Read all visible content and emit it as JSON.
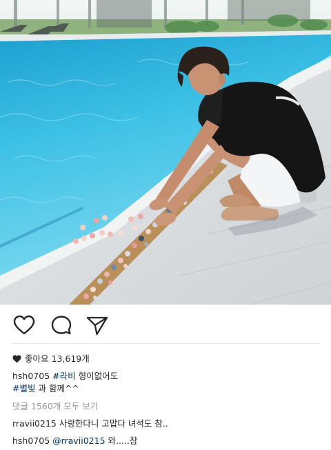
{
  "post": {
    "likes_label": "좋아요",
    "likes_count": "13,619개",
    "caption": {
      "username": "hsh0705",
      "hashtag1": "#라비",
      "text1": "형이없어도",
      "hashtag2": "#별빛",
      "text2": "과 함께^^"
    },
    "view_comments": "댓글 1560개 모두 보기",
    "comments": [
      {
        "username": "rravii0215",
        "text": "사랑한다니 고맙다 녀석도 참.."
      },
      {
        "username": "hsh0705",
        "mention": "@rravii0215",
        "text": "와.....참"
      }
    ]
  },
  "icons": {
    "like": "heart-outline-icon",
    "comment": "speech-bubble-icon",
    "share": "paper-plane-icon",
    "likes_marker": "heart-filled-icon"
  },
  "colors": {
    "text": "#262626",
    "hashtag": "#003569",
    "muted": "#999999",
    "pool": "#35b8e0"
  }
}
